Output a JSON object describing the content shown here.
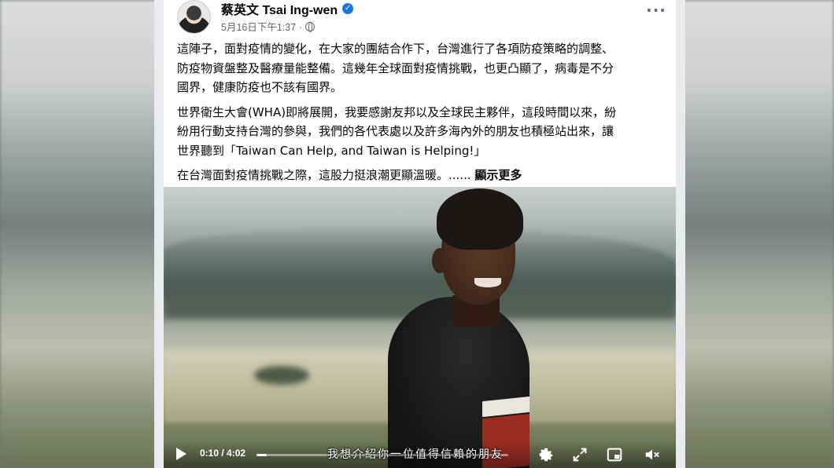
{
  "post": {
    "author": "蔡英文 Tsai Ing-wen",
    "timestamp": "5月16日下午1:37 ·",
    "paragraphs": [
      "這陣子，面對疫情的變化，在大家的團結合作下，台灣進行了各項防疫策略的調整、\n防疫物資盤整及醫療量能整備。這幾年全球面對疫情挑戰，也更凸顯了，病毒是不分\n國界，健康防疫也不該有國界。",
      "世界衛生大會(WHA)即將展開，我要感謝友邦以及全球民主夥伴，這段時間以來，紛\n紛用行動支持台灣的參與，我們的各代表處以及許多海內外的朋友也積極站出來，讓\n世界聽到「Taiwan Can Help, and Taiwan is Helping!」"
    ],
    "last_line": "在台灣面對疫情挑戰之際，這股力挺浪潮更顯溫暖。......",
    "see_more": "顯示更多"
  },
  "video": {
    "time": "0:10 / 4:02",
    "progress": 0.041,
    "subtitle": "我想介紹你一位值得信賴的朋友"
  },
  "icons": {
    "verified": "verified-badge-icon",
    "privacy": "globe-icon",
    "more": "more-options-icon",
    "play": "play-icon",
    "settings": "gear-icon",
    "fullscreen": "expand-icon",
    "pip": "picture-in-picture-icon",
    "volume": "mute-icon"
  },
  "colors": {
    "verified": "#1b74e4",
    "meta_text": "#65676b",
    "body_text": "#050505"
  }
}
